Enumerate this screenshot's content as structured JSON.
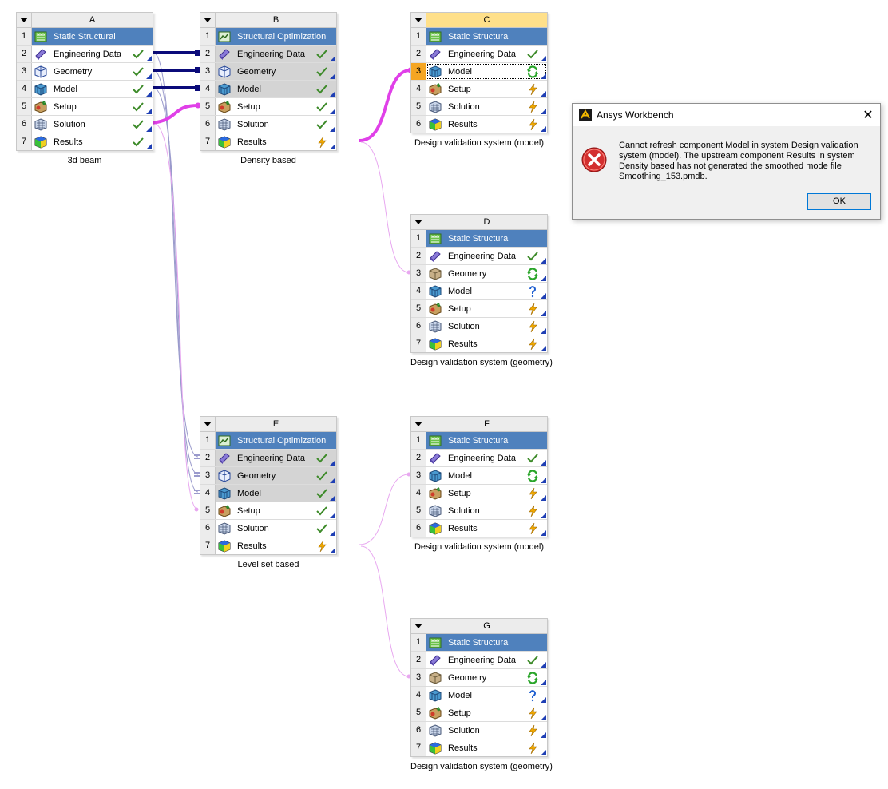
{
  "systems": {
    "A": {
      "letter": "A",
      "caption": "3d beam",
      "rows": [
        {
          "num": "1",
          "label": "Static Structural"
        },
        {
          "num": "2",
          "label": "Engineering Data"
        },
        {
          "num": "3",
          "label": "Geometry"
        },
        {
          "num": "4",
          "label": "Model"
        },
        {
          "num": "5",
          "label": "Setup"
        },
        {
          "num": "6",
          "label": "Solution"
        },
        {
          "num": "7",
          "label": "Results"
        }
      ]
    },
    "B": {
      "letter": "B",
      "caption": "Density based",
      "rows": [
        {
          "num": "1",
          "label": "Structural Optimization"
        },
        {
          "num": "2",
          "label": "Engineering Data"
        },
        {
          "num": "3",
          "label": "Geometry"
        },
        {
          "num": "4",
          "label": "Model"
        },
        {
          "num": "5",
          "label": "Setup"
        },
        {
          "num": "6",
          "label": "Solution"
        },
        {
          "num": "7",
          "label": "Results"
        }
      ]
    },
    "C": {
      "letter": "C",
      "caption": "Design validation system (model)",
      "rows": [
        {
          "num": "1",
          "label": "Static Structural"
        },
        {
          "num": "2",
          "label": "Engineering Data"
        },
        {
          "num": "3",
          "label": "Model"
        },
        {
          "num": "4",
          "label": "Setup"
        },
        {
          "num": "5",
          "label": "Solution"
        },
        {
          "num": "6",
          "label": "Results"
        }
      ]
    },
    "D": {
      "letter": "D",
      "caption": "Design validation system (geometry)",
      "rows": [
        {
          "num": "1",
          "label": "Static Structural"
        },
        {
          "num": "2",
          "label": "Engineering Data"
        },
        {
          "num": "3",
          "label": "Geometry"
        },
        {
          "num": "4",
          "label": "Model"
        },
        {
          "num": "5",
          "label": "Setup"
        },
        {
          "num": "6",
          "label": "Solution"
        },
        {
          "num": "7",
          "label": "Results"
        }
      ]
    },
    "E": {
      "letter": "E",
      "caption": "Level set based",
      "rows": [
        {
          "num": "1",
          "label": "Structural Optimization"
        },
        {
          "num": "2",
          "label": "Engineering Data"
        },
        {
          "num": "3",
          "label": "Geometry"
        },
        {
          "num": "4",
          "label": "Model"
        },
        {
          "num": "5",
          "label": "Setup"
        },
        {
          "num": "6",
          "label": "Solution"
        },
        {
          "num": "7",
          "label": "Results"
        }
      ]
    },
    "F": {
      "letter": "F",
      "caption": "Design validation system (model)",
      "rows": [
        {
          "num": "1",
          "label": "Static Structural"
        },
        {
          "num": "2",
          "label": "Engineering Data"
        },
        {
          "num": "3",
          "label": "Model"
        },
        {
          "num": "4",
          "label": "Setup"
        },
        {
          "num": "5",
          "label": "Solution"
        },
        {
          "num": "6",
          "label": "Results"
        }
      ]
    },
    "G": {
      "letter": "G",
      "caption": "Design validation system (geometry)",
      "rows": [
        {
          "num": "1",
          "label": "Static Structural"
        },
        {
          "num": "2",
          "label": "Engineering Data"
        },
        {
          "num": "3",
          "label": "Geometry"
        },
        {
          "num": "4",
          "label": "Model"
        },
        {
          "num": "5",
          "label": "Setup"
        },
        {
          "num": "6",
          "label": "Solution"
        },
        {
          "num": "7",
          "label": "Results"
        }
      ]
    }
  },
  "dialog": {
    "title": "Ansys Workbench",
    "message": "Cannot refresh component Model in system Design validation system (model). The upstream component Results in system Density based has not generated the smoothed mode file Smoothing_153.pmdb.",
    "ok_label": "OK"
  },
  "colors": {
    "title_bar": "#4f81bd",
    "shared_row": "#d4d4d4",
    "active_header": "#ffe08a",
    "highlight_num": "#f5a623",
    "link_dark": "#0b0b7a",
    "link_magenta": "#e040e8",
    "link_light": "#e8a8f0",
    "check": "#3c8a28",
    "refresh": "#2aa52a",
    "lightning": "#f0a800",
    "question": "#1f5fd0"
  }
}
